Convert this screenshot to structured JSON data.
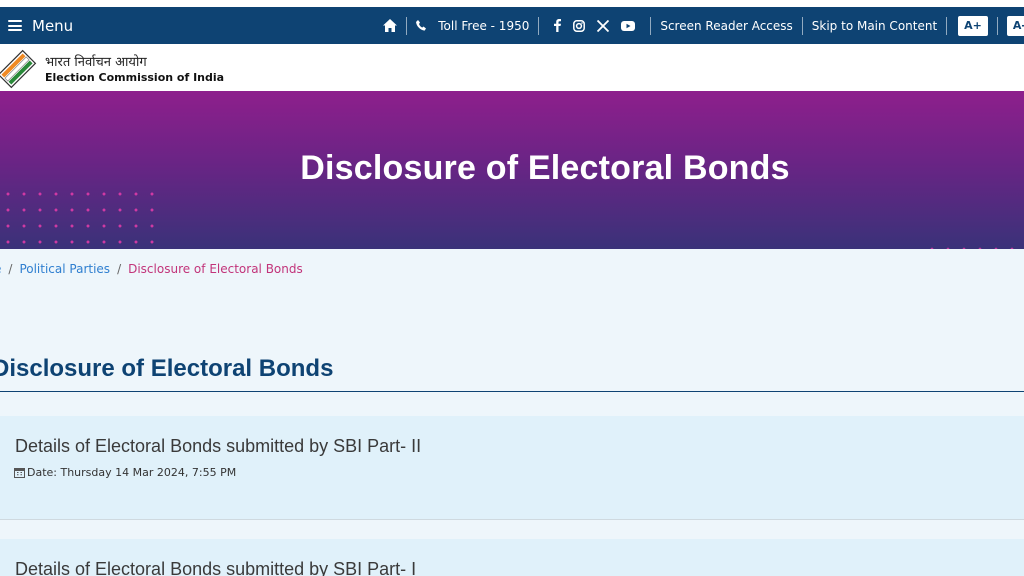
{
  "topbar": {
    "menu_label": "Menu",
    "toll_free": "Toll Free - 1950",
    "screen_reader": "Screen Reader Access",
    "skip_main": "Skip to Main Content",
    "font_increase": "A+",
    "font_decrease": "A-"
  },
  "icons": [
    "home-icon",
    "phone-icon",
    "facebook-icon",
    "instagram-icon",
    "x-icon",
    "youtube-icon",
    "calendar-icon"
  ],
  "logo": {
    "hindi": "भारत निर्वाचन आयोग",
    "english": "Election Commission of India"
  },
  "banner": {
    "title": "Disclosure of Electoral Bonds"
  },
  "breadcrumb": {
    "home": "e",
    "parent": "Political Parties",
    "current": "Disclosure of Electoral Bonds"
  },
  "main": {
    "heading": "Disclosure of Electoral Bonds",
    "items": [
      {
        "title": "Details of Electoral Bonds submitted by SBI Part- II",
        "date": "Date: Thursday 14 Mar 2024, 7:55 PM"
      },
      {
        "title": "Details of Electoral Bonds submitted by SBI Part- I"
      }
    ]
  },
  "colors": {
    "topbar": "#0e4373",
    "banner_top": "#8e1f8c",
    "banner_bottom": "#3a3279",
    "breadcrumb_link": "#2f7fd0",
    "breadcrumb_current": "#c2347a",
    "card_bg": "#e0f1fa"
  }
}
